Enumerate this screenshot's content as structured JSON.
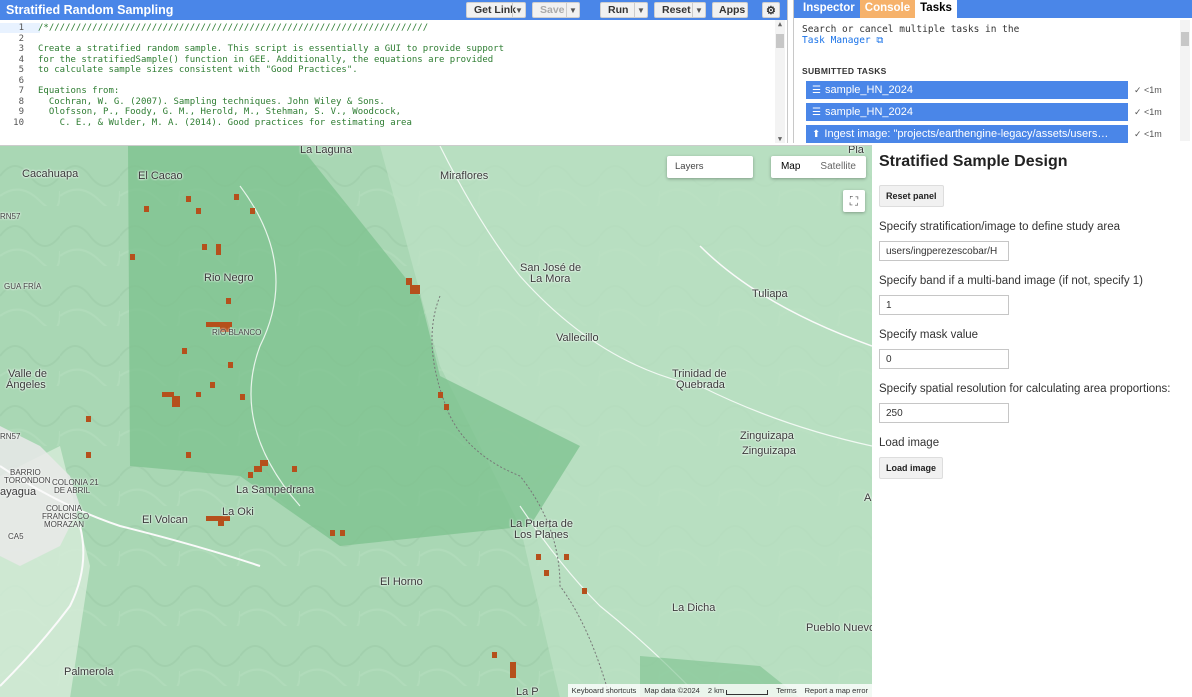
{
  "editor": {
    "title": "Stratified Random Sampling",
    "buttons": {
      "get_link": "Get Link",
      "save": "Save",
      "run": "Run",
      "reset": "Reset",
      "apps": "Apps",
      "settings_icon": "gear-icon"
    },
    "lines": [
      {
        "n": "1",
        "t": "/*//////////////////////////////////////////////////////////////////////"
      },
      {
        "n": "2",
        "t": ""
      },
      {
        "n": "3",
        "t": "Create a stratified random sample. This script is essentially a GUI to provide support"
      },
      {
        "n": "4",
        "t": "for the stratifiedSample() function in GEE. Additionally, the equations are provided"
      },
      {
        "n": "5",
        "t": "to calculate sample sizes consistent with \"Good Practices\"."
      },
      {
        "n": "6",
        "t": ""
      },
      {
        "n": "7",
        "t": "Equations from:"
      },
      {
        "n": "8",
        "t": "  Cochran, W. G. (2007). Sampling techniques. John Wiley & Sons."
      },
      {
        "n": "9",
        "t": "  Olofsson, P., Foody, G. M., Herold, M., Stehman, S. V., Woodcock,"
      },
      {
        "n": "10",
        "t": "    C. E., & Wulder, M. A. (2014). Good practices for estimating area"
      }
    ]
  },
  "right_panel": {
    "tabs": [
      "Inspector",
      "Console",
      "Tasks"
    ],
    "description": "Search or cancel multiple tasks in the",
    "task_manager_link": "Task Manager",
    "submitted_heading": "SUBMITTED TASKS",
    "tasks": [
      {
        "icon": "table-icon",
        "label": "sample_HN_2024",
        "status": "✓ <1m"
      },
      {
        "icon": "table-icon",
        "label": "sample_HN_2024",
        "status": "✓ <1m"
      },
      {
        "icon": "upload-icon",
        "label": "Ingest image: \"projects/earthengine-legacy/assets/users…",
        "status": "✓ <1m"
      }
    ]
  },
  "map": {
    "layers_label": "Layers",
    "map_type": {
      "map": "Map",
      "satellite": "Satellite"
    },
    "places": [
      "La Laguna",
      "Cacahuapa",
      "El Cacao",
      "Miraflores",
      "Rio Negro",
      "San José de",
      "La Mora",
      "Tuliapa",
      "Vallecillo",
      "Valle de",
      "Ángeles",
      "Trinidad de",
      "Quebrada",
      "Zinguizapa",
      "Zinguizapa",
      "La Sampedrana",
      "El Volcan",
      "La Oki",
      "La Puerta de",
      "Los Planes",
      "El Horno",
      "La Dicha",
      "Pueblo Nuevo",
      "Palmerola",
      "RIO BLANCO",
      "GUA FRÍA",
      "BARRIO",
      "TORONDON",
      "COLONIA 21",
      "DE ABRIL",
      "COLONIA",
      "FRANCISCO",
      "MORAZAN",
      "ayagua",
      "RN57",
      "RN57",
      "CA5",
      "Pla",
      "A",
      "La P"
    ],
    "attribution": {
      "shortcuts": "Keyboard shortcuts",
      "data": "Map data ©2024",
      "scale": "2 km",
      "terms": "Terms",
      "report": "Report a map error"
    },
    "colors": {
      "terrain": "#a9d7b4",
      "study_area": "#7cc28e",
      "sample": "#b5501c"
    }
  },
  "side_panel": {
    "title": "Stratified Sample Design",
    "reset_button": "Reset panel",
    "stratification_label": "Specify stratification/image to define study area",
    "stratification_value": "users/ingperezescobar/H",
    "band_label": "Specify band if a multi-band image (if not, specify 1)",
    "band_value": "1",
    "mask_label": "Specify mask value",
    "mask_value": "0",
    "resolution_label": "Specify spatial resolution for calculating area proportions:",
    "resolution_value": "250",
    "load_label": "Load image",
    "load_button": "Load image"
  }
}
